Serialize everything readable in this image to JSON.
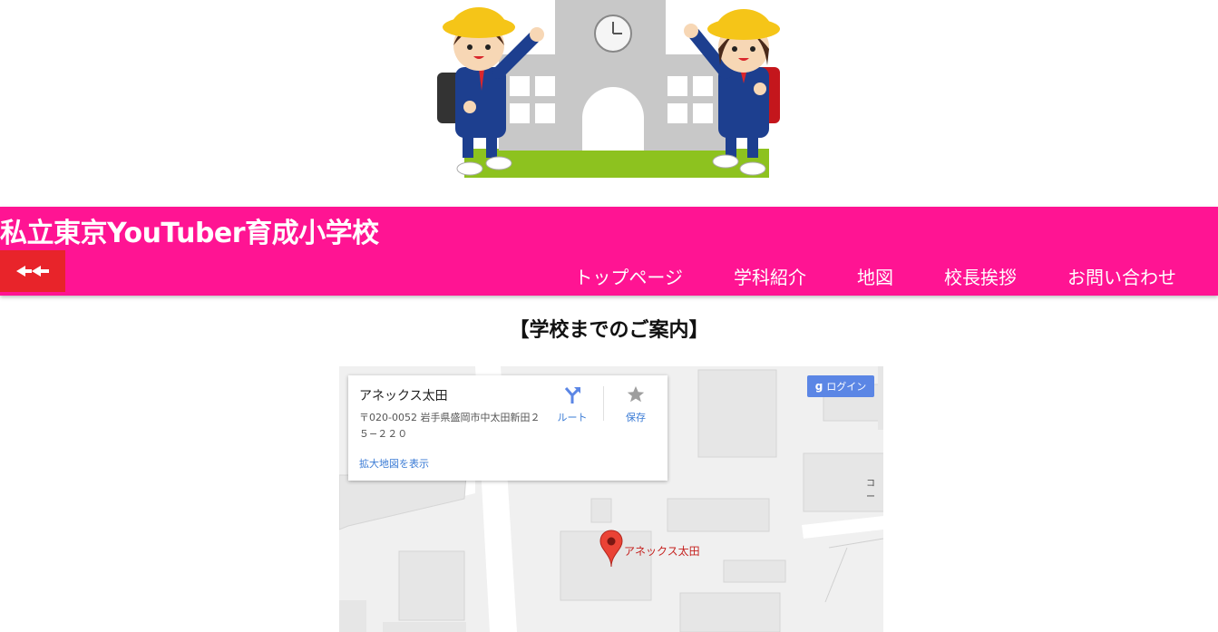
{
  "header": {
    "title": "私立東京YouTuber育成小学校",
    "menu_toggle_icon": "collapse-arrows-icon",
    "brand_color": "#ff1493",
    "toggle_color": "#e8242a"
  },
  "nav": {
    "items": [
      {
        "label": "トップページ"
      },
      {
        "label": "学科紹介"
      },
      {
        "label": "地図"
      },
      {
        "label": "校長挨拶"
      },
      {
        "label": "お問い合わせ"
      }
    ]
  },
  "main": {
    "section_title": "【学校までのご案内】"
  },
  "map": {
    "place_name": "アネックス太田",
    "address": "〒020-0052 岩手県盛岡市中太田新田２５−２２０",
    "route_label": "ルート",
    "save_label": "保存",
    "larger_map_link": "拡大地図を表示",
    "login_label": "ログイン",
    "marker_label": "アネックス太田",
    "street_label": "コー"
  }
}
